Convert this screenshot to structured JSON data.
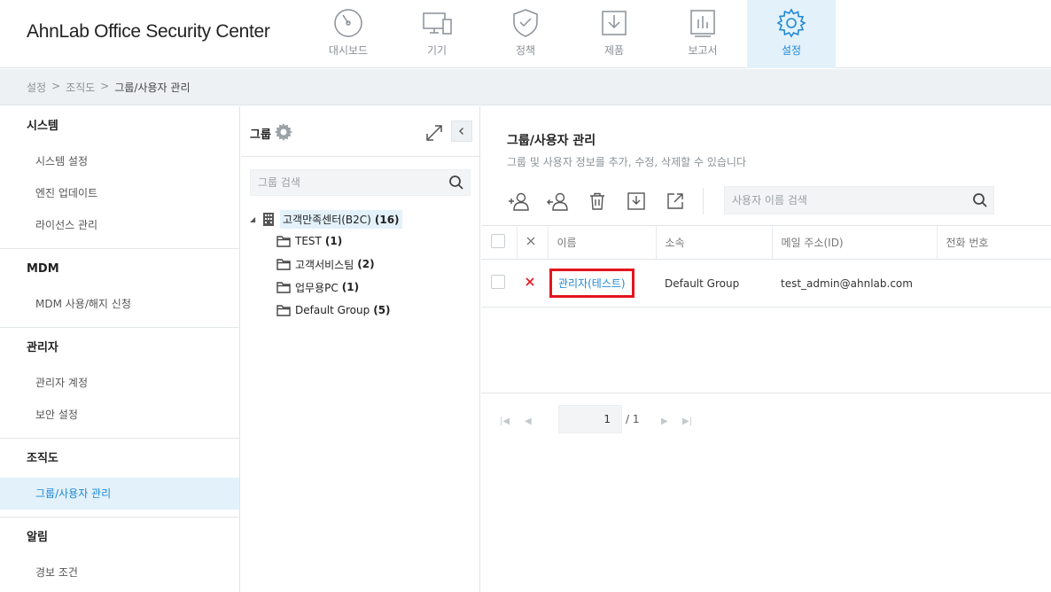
{
  "app": {
    "title": "AhnLab Office Security Center"
  },
  "nav": [
    {
      "label": "대시보드",
      "icon": "gauge-icon",
      "active": false
    },
    {
      "label": "기기",
      "icon": "devices-icon",
      "active": false
    },
    {
      "label": "정책",
      "icon": "shield-check-icon",
      "active": false
    },
    {
      "label": "제품",
      "icon": "download-box-icon",
      "active": false
    },
    {
      "label": "보고서",
      "icon": "report-chart-icon",
      "active": false
    },
    {
      "label": "설정",
      "icon": "gear-icon",
      "active": true
    }
  ],
  "breadcrumb": {
    "items": [
      "설정",
      "조직도",
      "그룹/사용자 관리"
    ],
    "separator": ">"
  },
  "sidebar": {
    "sections": [
      {
        "title": "시스템",
        "items": [
          "시스템 설정",
          "엔진 업데이트",
          "라이선스 관리"
        ]
      },
      {
        "title": "MDM",
        "items": [
          "MDM 사용/해지 신청"
        ]
      },
      {
        "title": "관리자",
        "items": [
          "관리자 계정",
          "보안 설정"
        ]
      },
      {
        "title": "조직도",
        "items": [
          "그룹/사용자 관리"
        ]
      },
      {
        "title": "알림",
        "items": [
          "경보 조건"
        ]
      }
    ],
    "active_item": "그룹/사용자 관리"
  },
  "group_panel": {
    "title": "그룹",
    "search_placeholder": "그룹 검색",
    "tree": {
      "root": {
        "label": "고객만족센터(B2C)",
        "count": "(16)"
      },
      "children": [
        {
          "label": "TEST",
          "count": "(1)"
        },
        {
          "label": "고객서비스팀",
          "count": "(2)"
        },
        {
          "label": "업무용PC",
          "count": "(1)"
        },
        {
          "label": "Default Group",
          "count": "(5)"
        }
      ]
    }
  },
  "main": {
    "title": "그룹/사용자 관리",
    "subtitle": "그룹 및 사용자 정보를 추가, 수정, 삭제할 수 있습니다",
    "user_search_placeholder": "사용자 이름 검색",
    "toolbar": [
      "add-user-icon",
      "move-user-icon",
      "trash-icon",
      "import-icon",
      "export-icon"
    ],
    "table": {
      "columns": [
        "이름",
        "소속",
        "메일 주소(ID)",
        "전화 번호"
      ],
      "rows": [
        {
          "name": "관리자(테스트)",
          "group": "Default Group",
          "email": "test_admin@ahnlab.com",
          "phone": ""
        }
      ]
    },
    "pagination": {
      "current": "1",
      "total": "/ 1"
    }
  },
  "colors": {
    "accent": "#1e88d6",
    "highlight": "#e3151e",
    "active_bg": "#e3f1fb"
  }
}
